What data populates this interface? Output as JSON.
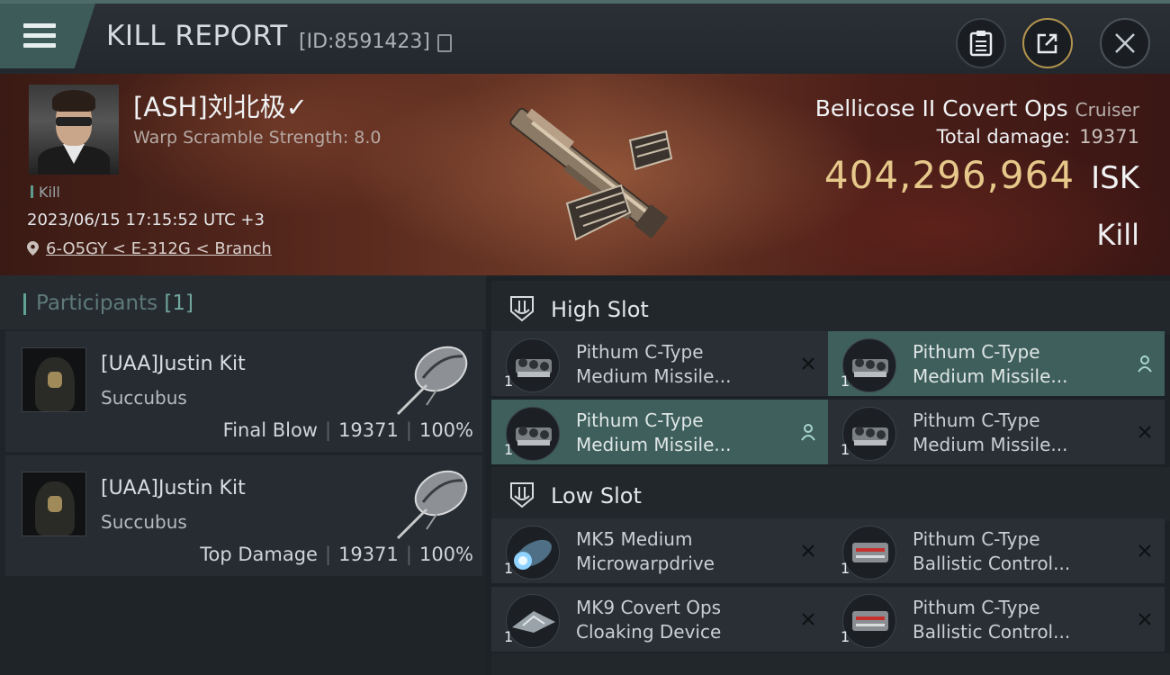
{
  "header": {
    "title": "KILL REPORT",
    "report_id": "[ID:8591423]",
    "icons": {
      "menu": "hamburger-menu-icon",
      "copy": "copy-icon",
      "clipboard": "clipboard-icon",
      "share": "share-icon",
      "close": "close-icon"
    }
  },
  "victim": {
    "name": "[ASH]刘北极✓",
    "warp_scramble": "Warp Scramble Strength: 8.0",
    "tag": "Kill",
    "datetime": "2023/06/15 17:15:52 UTC +3",
    "location": "6-O5GY < E-312G < Branch"
  },
  "ship": {
    "name": "Bellicose II Covert Ops",
    "class": "Cruiser",
    "total_damage_label": "Total damage:",
    "total_damage": "19371",
    "isk_value": "404,296,964",
    "currency": "ISK",
    "result": "Kill"
  },
  "participants": {
    "title": "Participants",
    "count": "[1]",
    "rows": [
      {
        "name": "[UAA]Justin Kit",
        "ship": "Succubus",
        "role": "Final Blow",
        "damage": "19371",
        "percent": "100%"
      },
      {
        "name": "[UAA]Justin Kit",
        "ship": "Succubus",
        "role": "Top Damage",
        "damage": "19371",
        "percent": "100%"
      }
    ]
  },
  "slots": {
    "high": {
      "title": "High Slot",
      "items": [
        {
          "line1": "Pithum C-Type",
          "line2": "Medium Missile...",
          "qty": "1",
          "status": "destroyed"
        },
        {
          "line1": "Pithum C-Type",
          "line2": "Medium Missile...",
          "qty": "1",
          "status": "dropped"
        },
        {
          "line1": "Pithum C-Type",
          "line2": "Medium Missile...",
          "qty": "1",
          "status": "dropped"
        },
        {
          "line1": "Pithum C-Type",
          "line2": "Medium Missile...",
          "qty": "1",
          "status": "destroyed"
        }
      ]
    },
    "low": {
      "title": "Low Slot",
      "items": [
        {
          "line1": "MK5 Medium",
          "line2": "Microwarpdrive",
          "qty": "1",
          "status": "destroyed"
        },
        {
          "line1": "Pithum C-Type",
          "line2": "Ballistic Control...",
          "qty": "1",
          "status": "destroyed"
        },
        {
          "line1": "MK9 Covert Ops",
          "line2": "Cloaking Device",
          "qty": "1",
          "status": "destroyed"
        },
        {
          "line1": "Pithum C-Type",
          "line2": "Ballistic Control...",
          "qty": "1",
          "status": "destroyed"
        }
      ]
    }
  },
  "colors": {
    "accent": "#5fa395",
    "isk": "#e6c88a",
    "highlight": "#3e5f5b"
  }
}
